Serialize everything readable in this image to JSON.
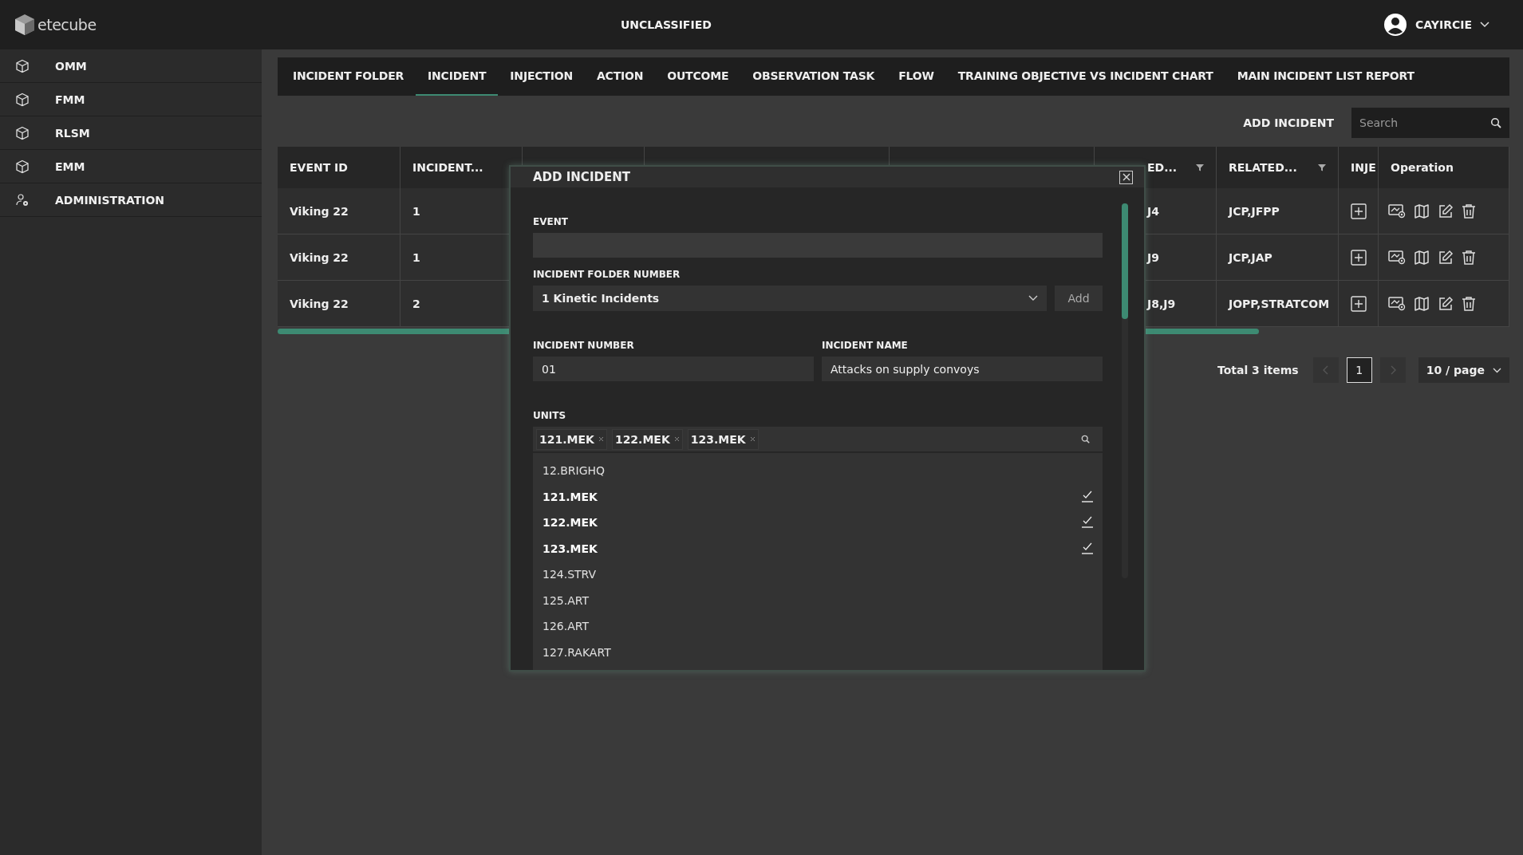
{
  "header": {
    "logo_text": "etecube",
    "classification": "UNCLASSIFIED",
    "user": "CAYIRCIE"
  },
  "sidebar": {
    "items": [
      {
        "label": "OMM",
        "kind": "module",
        "selected": false
      },
      {
        "label": "FMM",
        "kind": "module",
        "selected": false
      },
      {
        "label": "RLSM",
        "kind": "module",
        "selected": false
      },
      {
        "label": "EMM",
        "kind": "module",
        "selected": false
      },
      {
        "label": "ADMINISTRATION",
        "kind": "admin",
        "selected": false
      }
    ]
  },
  "tabs": [
    {
      "label": "INCIDENT FOLDER",
      "selected": false
    },
    {
      "label": "INCIDENT",
      "selected": true
    },
    {
      "label": "INJECTION",
      "selected": false
    },
    {
      "label": "ACTION",
      "selected": false
    },
    {
      "label": "OUTCOME",
      "selected": false
    },
    {
      "label": "OBSERVATION TASK",
      "selected": false
    },
    {
      "label": "FLOW",
      "selected": false
    },
    {
      "label": "TRAINING OBJECTIVE VS INCIDENT CHART",
      "selected": false
    },
    {
      "label": "MAIN INCIDENT LIST REPORT",
      "selected": false
    }
  ],
  "toolbar": {
    "add_button": "ADD INCIDENT",
    "search": {
      "placeholder": "Search"
    }
  },
  "table": {
    "columns": [
      {
        "label": "EVENT ID",
        "filter": false
      },
      {
        "label": "INCIDENT...",
        "filter": false
      },
      {
        "label": "ED...",
        "filter": true
      },
      {
        "label": "RELATED...",
        "filter": true
      },
      {
        "label": "INJE",
        "filter": false
      },
      {
        "label": "Operation",
        "filter": false
      }
    ],
    "rows": [
      {
        "event_id": "Viking 22",
        "incident": "1",
        "column_6": "J4",
        "related": "JCP,JFPP"
      },
      {
        "event_id": "Viking 22",
        "incident": "1",
        "column_6": "J9",
        "related": "JCP,JAP"
      },
      {
        "event_id": "Viking 22",
        "incident": "2",
        "column_6": "J8,J9",
        "related": "JOPP,STRATCOM"
      }
    ]
  },
  "pagination": {
    "total": "Total 3 items",
    "pages": [
      {
        "label": "1",
        "selected": true
      }
    ],
    "prev_disabled": true,
    "next_disabled": true,
    "page_size": "10 / page"
  },
  "modal": {
    "title": "ADD INCIDENT",
    "event": {
      "label": "EVENT",
      "disabled": true
    },
    "folder": {
      "label": "INCIDENT FOLDER NUMBER",
      "value": "1 Kinetic Incidents",
      "add_button": "Add"
    },
    "incident_number": {
      "label": "INCIDENT NUMBER",
      "value": "01"
    },
    "incident_name": {
      "label": "INCIDENT NAME",
      "value": "Attacks on supply convoys"
    },
    "units": {
      "label": "UNITS",
      "tags": [
        "121.MEK",
        "122.MEK",
        "123.MEK"
      ],
      "options": [
        {
          "label": "12.BRIGHQ",
          "selected": false
        },
        {
          "label": "121.MEK",
          "selected": true
        },
        {
          "label": "122.MEK",
          "selected": true
        },
        {
          "label": "123.MEK",
          "selected": true
        },
        {
          "label": "124.STRV",
          "selected": false
        },
        {
          "label": "125.ART",
          "selected": false
        },
        {
          "label": "126.ART",
          "selected": false
        },
        {
          "label": "127.RAKART",
          "selected": false
        }
      ]
    }
  }
}
